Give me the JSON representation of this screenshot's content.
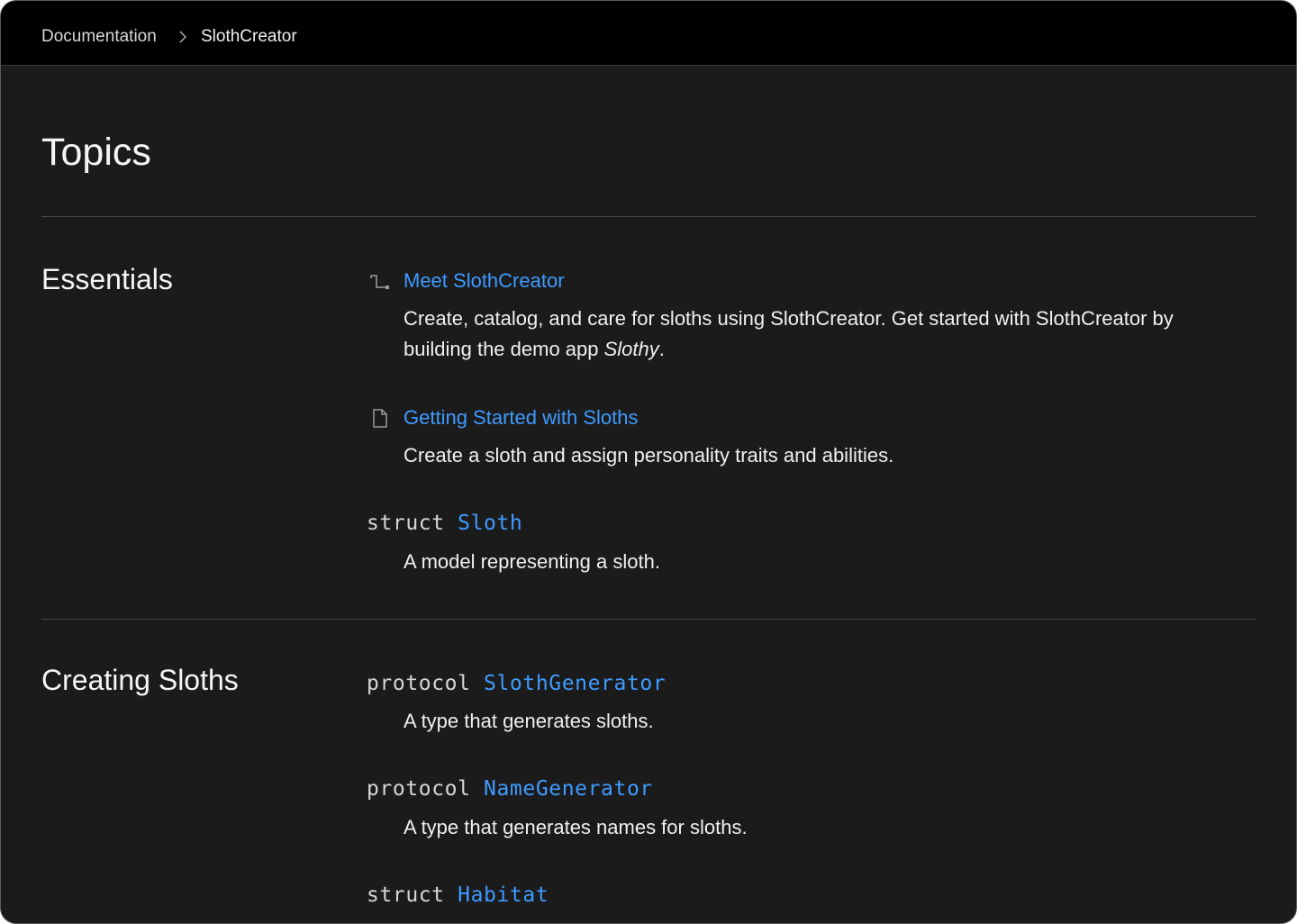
{
  "breadcrumb": {
    "root": "Documentation",
    "current": "SlothCreator"
  },
  "page": {
    "title": "Topics"
  },
  "sections": [
    {
      "title": "Essentials",
      "items": [
        {
          "kind": "tutorial",
          "icon": "tutorial-icon",
          "title": "Meet SlothCreator",
          "desc_before": "Create, catalog, and care for sloths using SlothCreator. Get started with SlothCreator by building the demo app ",
          "desc_emph": "Slothy",
          "desc_after": "."
        },
        {
          "kind": "article",
          "icon": "article-icon",
          "title": "Getting Started with Sloths",
          "desc": "Create a sloth and assign personality traits and abilities."
        },
        {
          "kind": "symbol",
          "keyword": "struct",
          "name": "Sloth",
          "desc": "A model representing a sloth."
        }
      ]
    },
    {
      "title": "Creating Sloths",
      "items": [
        {
          "kind": "symbol",
          "keyword": "protocol",
          "name": "SlothGenerator",
          "desc": "A type that generates sloths."
        },
        {
          "kind": "symbol",
          "keyword": "protocol",
          "name": "NameGenerator",
          "desc": "A type that generates names for sloths."
        },
        {
          "kind": "symbol",
          "keyword": "struct",
          "name": "Habitat"
        }
      ]
    }
  ],
  "colors": {
    "background": "#1b1b1b",
    "navbar": "#000000",
    "link": "#3e9bff",
    "text": "#f0f0f0",
    "divider": "#4a4a4a"
  }
}
